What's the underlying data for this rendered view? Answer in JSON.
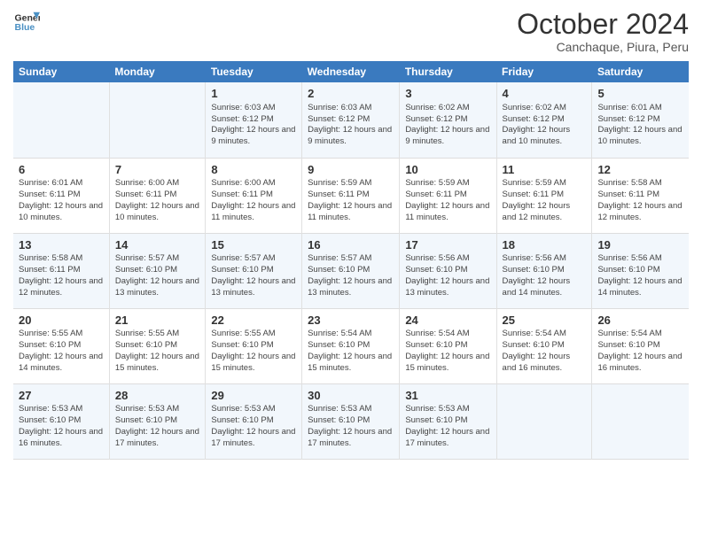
{
  "header": {
    "logo_line1": "General",
    "logo_line2": "Blue",
    "month": "October 2024",
    "location": "Canchaque, Piura, Peru"
  },
  "weekdays": [
    "Sunday",
    "Monday",
    "Tuesday",
    "Wednesday",
    "Thursday",
    "Friday",
    "Saturday"
  ],
  "weeks": [
    [
      {
        "day": "",
        "info": ""
      },
      {
        "day": "",
        "info": ""
      },
      {
        "day": "1",
        "info": "Sunrise: 6:03 AM\nSunset: 6:12 PM\nDaylight: 12 hours and 9 minutes."
      },
      {
        "day": "2",
        "info": "Sunrise: 6:03 AM\nSunset: 6:12 PM\nDaylight: 12 hours and 9 minutes."
      },
      {
        "day": "3",
        "info": "Sunrise: 6:02 AM\nSunset: 6:12 PM\nDaylight: 12 hours and 9 minutes."
      },
      {
        "day": "4",
        "info": "Sunrise: 6:02 AM\nSunset: 6:12 PM\nDaylight: 12 hours and 10 minutes."
      },
      {
        "day": "5",
        "info": "Sunrise: 6:01 AM\nSunset: 6:12 PM\nDaylight: 12 hours and 10 minutes."
      }
    ],
    [
      {
        "day": "6",
        "info": "Sunrise: 6:01 AM\nSunset: 6:11 PM\nDaylight: 12 hours and 10 minutes."
      },
      {
        "day": "7",
        "info": "Sunrise: 6:00 AM\nSunset: 6:11 PM\nDaylight: 12 hours and 10 minutes."
      },
      {
        "day": "8",
        "info": "Sunrise: 6:00 AM\nSunset: 6:11 PM\nDaylight: 12 hours and 11 minutes."
      },
      {
        "day": "9",
        "info": "Sunrise: 5:59 AM\nSunset: 6:11 PM\nDaylight: 12 hours and 11 minutes."
      },
      {
        "day": "10",
        "info": "Sunrise: 5:59 AM\nSunset: 6:11 PM\nDaylight: 12 hours and 11 minutes."
      },
      {
        "day": "11",
        "info": "Sunrise: 5:59 AM\nSunset: 6:11 PM\nDaylight: 12 hours and 12 minutes."
      },
      {
        "day": "12",
        "info": "Sunrise: 5:58 AM\nSunset: 6:11 PM\nDaylight: 12 hours and 12 minutes."
      }
    ],
    [
      {
        "day": "13",
        "info": "Sunrise: 5:58 AM\nSunset: 6:11 PM\nDaylight: 12 hours and 12 minutes."
      },
      {
        "day": "14",
        "info": "Sunrise: 5:57 AM\nSunset: 6:10 PM\nDaylight: 12 hours and 13 minutes."
      },
      {
        "day": "15",
        "info": "Sunrise: 5:57 AM\nSunset: 6:10 PM\nDaylight: 12 hours and 13 minutes."
      },
      {
        "day": "16",
        "info": "Sunrise: 5:57 AM\nSunset: 6:10 PM\nDaylight: 12 hours and 13 minutes."
      },
      {
        "day": "17",
        "info": "Sunrise: 5:56 AM\nSunset: 6:10 PM\nDaylight: 12 hours and 13 minutes."
      },
      {
        "day": "18",
        "info": "Sunrise: 5:56 AM\nSunset: 6:10 PM\nDaylight: 12 hours and 14 minutes."
      },
      {
        "day": "19",
        "info": "Sunrise: 5:56 AM\nSunset: 6:10 PM\nDaylight: 12 hours and 14 minutes."
      }
    ],
    [
      {
        "day": "20",
        "info": "Sunrise: 5:55 AM\nSunset: 6:10 PM\nDaylight: 12 hours and 14 minutes."
      },
      {
        "day": "21",
        "info": "Sunrise: 5:55 AM\nSunset: 6:10 PM\nDaylight: 12 hours and 15 minutes."
      },
      {
        "day": "22",
        "info": "Sunrise: 5:55 AM\nSunset: 6:10 PM\nDaylight: 12 hours and 15 minutes."
      },
      {
        "day": "23",
        "info": "Sunrise: 5:54 AM\nSunset: 6:10 PM\nDaylight: 12 hours and 15 minutes."
      },
      {
        "day": "24",
        "info": "Sunrise: 5:54 AM\nSunset: 6:10 PM\nDaylight: 12 hours and 15 minutes."
      },
      {
        "day": "25",
        "info": "Sunrise: 5:54 AM\nSunset: 6:10 PM\nDaylight: 12 hours and 16 minutes."
      },
      {
        "day": "26",
        "info": "Sunrise: 5:54 AM\nSunset: 6:10 PM\nDaylight: 12 hours and 16 minutes."
      }
    ],
    [
      {
        "day": "27",
        "info": "Sunrise: 5:53 AM\nSunset: 6:10 PM\nDaylight: 12 hours and 16 minutes."
      },
      {
        "day": "28",
        "info": "Sunrise: 5:53 AM\nSunset: 6:10 PM\nDaylight: 12 hours and 17 minutes."
      },
      {
        "day": "29",
        "info": "Sunrise: 5:53 AM\nSunset: 6:10 PM\nDaylight: 12 hours and 17 minutes."
      },
      {
        "day": "30",
        "info": "Sunrise: 5:53 AM\nSunset: 6:10 PM\nDaylight: 12 hours and 17 minutes."
      },
      {
        "day": "31",
        "info": "Sunrise: 5:53 AM\nSunset: 6:10 PM\nDaylight: 12 hours and 17 minutes."
      },
      {
        "day": "",
        "info": ""
      },
      {
        "day": "",
        "info": ""
      }
    ]
  ]
}
